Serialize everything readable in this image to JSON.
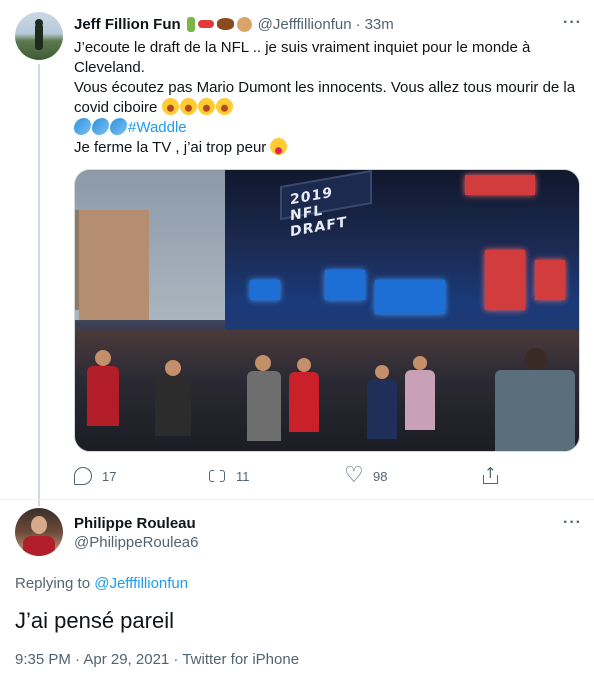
{
  "original_tweet": {
    "display_name": "Jeff Fillion Fun",
    "handle": "@Jefffillionfun",
    "separator": "·",
    "time_ago": "33m",
    "name_emoji_icons": [
      "golfer-icon",
      "pill-icon",
      "football-icon",
      "dog-face-icon"
    ],
    "text_lines": {
      "line1": "J’ecoute le draft de la NFL .. je suis vraiment inquiet pour le monde à Cleveland.",
      "line2": "Vous écoutez pas Mario Dumont les innocents. Vous allez tous mourir de la covid ciboire",
      "line2_emoji_icon": "face-with-tears-of-joy-icon",
      "line2_emoji_count": 4,
      "line3_emoji_icon": "dolphin-icon",
      "line3_emoji_count": 3,
      "hashtag": "#Waddle",
      "line4": "Je ferme la TV , j’ai trop peur",
      "line4_emoji_icon": "squinting-face-with-tongue-icon"
    },
    "media": {
      "banner_text": "2019 NFL DRAFT"
    },
    "actions": {
      "reply_count": "17",
      "retweet_count": "11",
      "like_count": "98"
    }
  },
  "reply_tweet": {
    "display_name": "Philippe Rouleau",
    "handle": "@PhilippeRoulea6",
    "replying_to_label": "Replying to",
    "replying_to_handle": "@Jefffillionfun",
    "text": "J’ai pensé pareil",
    "timestamp": "9:35 PM · Apr 29, 2021 · Twitter for iPhone"
  },
  "colors": {
    "accent": "#1d9bf0",
    "secondary_text": "#536471",
    "primary_text": "#0f1419",
    "divider": "#eff3f4"
  }
}
